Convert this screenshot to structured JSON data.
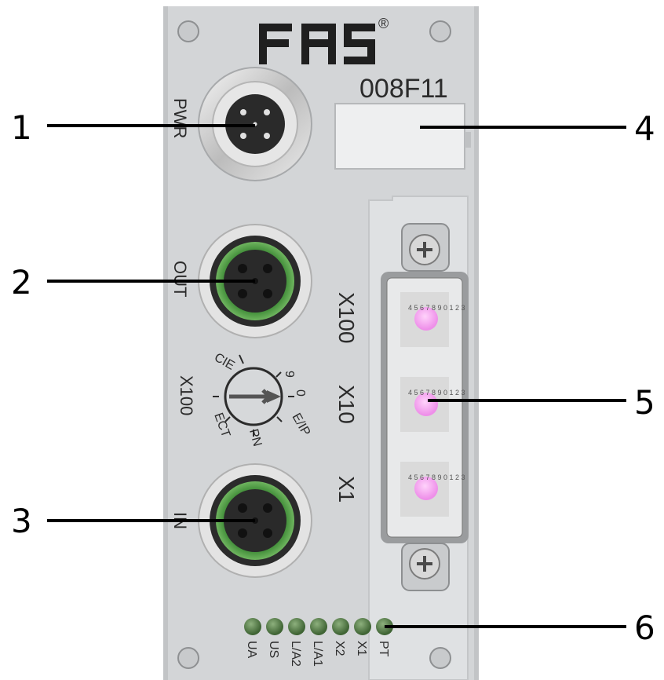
{
  "brand": {
    "logo_text": "FAS",
    "registered": "®"
  },
  "model": "008F11",
  "connectors": [
    {
      "label": "PWR",
      "type": "M8 power connector",
      "ring_color": "#c8c8c8"
    },
    {
      "label": "OUT",
      "type": "M12 green connector",
      "ring_color": "#3f8f3a"
    },
    {
      "label": "IN",
      "type": "M12 green connector",
      "ring_color": "#3f8f3a"
    }
  ],
  "switch_labels": {
    "x100": "X100",
    "x10": "X10",
    "x1": "X1"
  },
  "selector": {
    "label": "X100",
    "marks": [
      "CIE",
      "9",
      "0",
      "E/IP",
      "PN",
      "ECT"
    ]
  },
  "leds": [
    "UA",
    "US",
    "L/A2",
    "L/A1",
    "X2",
    "X1",
    "PT"
  ],
  "callouts": [
    "1",
    "2",
    "3",
    "4",
    "5",
    "6"
  ],
  "colors": {
    "housing": "#d3d5d7",
    "panel": "#dcdee0",
    "switch_dial": "#f2a8f0",
    "led": "#4d7a3f"
  }
}
